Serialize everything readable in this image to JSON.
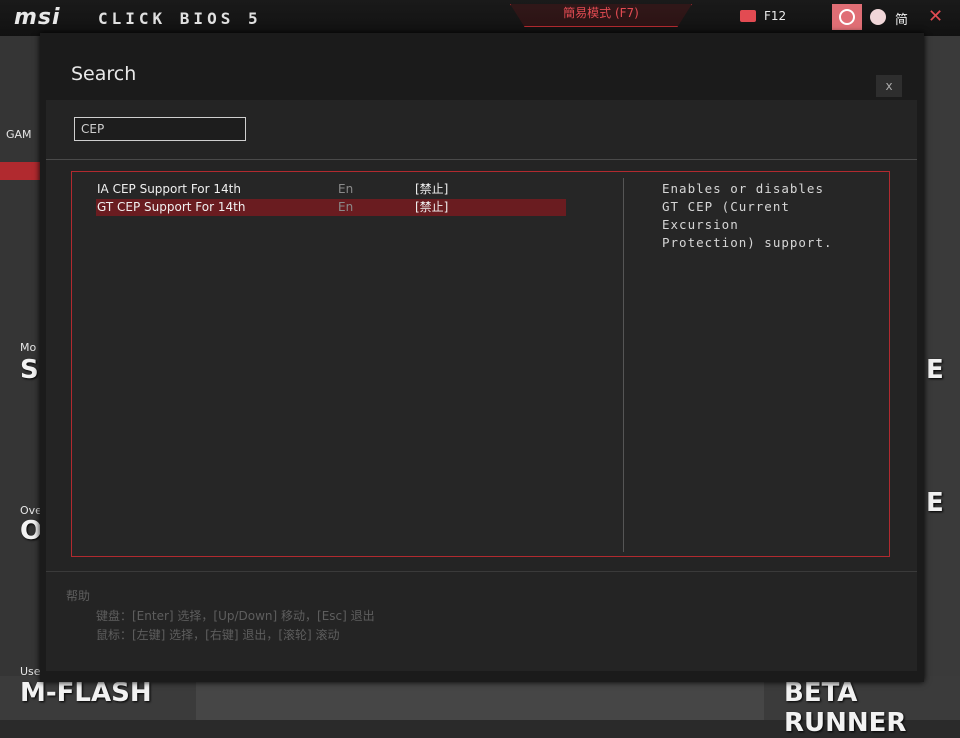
{
  "topbar": {
    "logo": "msi",
    "product": "CLICK BIOS 5",
    "ez_mode": "簡易模式 (F7)",
    "screenshot": "F12",
    "language": "简",
    "icons": {
      "screenshot": "camera-icon",
      "search": "search-icon",
      "language": "globe-icon",
      "close": "close-icon"
    }
  },
  "background": {
    "left_labels": [
      "GAM",
      "Mo",
      "SI",
      "Ove",
      "O",
      "Use"
    ],
    "tiles": {
      "mflash": "M-FLASH",
      "beta_runner": "BETA RUNNER",
      "right_partial_1": "E",
      "right_partial_2": "E"
    }
  },
  "search_dialog": {
    "title": "Search",
    "close_label": "x",
    "query": "CEP",
    "results": [
      {
        "name": "IA CEP Support For 14th",
        "category": "En",
        "value": "[禁止]",
        "selected": false
      },
      {
        "name": "GT CEP Support For 14th",
        "category": "En",
        "value": "[禁止]",
        "selected": true
      }
    ],
    "description": [
      "Enables or disables",
      "GT CEP (Current",
      "Excursion",
      "Protection) support."
    ],
    "help": {
      "title": "帮助",
      "keyboard": "键盘：[Enter] 选择，[Up/Down] 移动，[Esc] 退出",
      "mouse": "鼠标：[左键] 选择，[右键] 退出，[滚轮] 滚动"
    }
  },
  "colors": {
    "accent": "#b12a2f",
    "selected_row": "#6a1c20",
    "modal_bg": "#1b1b1b"
  }
}
